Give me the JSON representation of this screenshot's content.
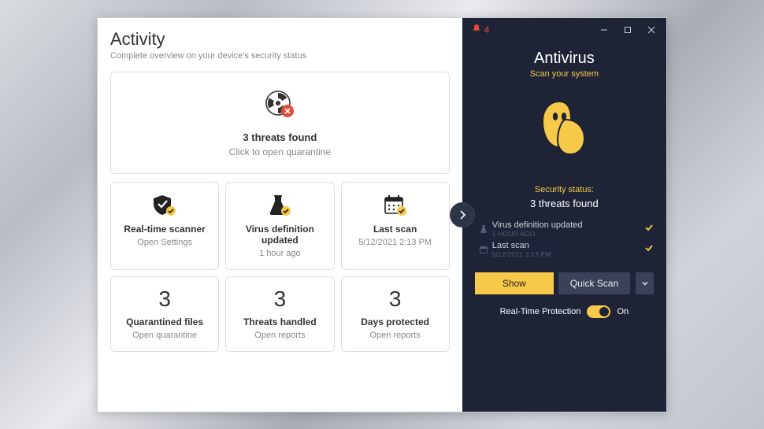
{
  "left": {
    "title": "Activity",
    "subtitle": "Complete overview on your device's security status",
    "hero": {
      "title": "3 threats found",
      "sub": "Click to open quarantine"
    },
    "cards": [
      {
        "title": "Real-time scanner",
        "sub": "Open Settings"
      },
      {
        "title": "Virus definition updated",
        "sub": "1 hour ago"
      },
      {
        "title": "Last scan",
        "sub": "5/12/2021 2:13 PM"
      },
      {
        "big": "3",
        "title": "Quarantined files",
        "sub": "Open quarantine"
      },
      {
        "big": "3",
        "title": "Threats handled",
        "sub": "Open reports"
      },
      {
        "big": "3",
        "title": "Days protected",
        "sub": "Open reports"
      }
    ]
  },
  "right": {
    "notif_count": "4",
    "title": "Antivirus",
    "sub": "Scan your system",
    "status_label": "Security status:",
    "status_value": "3 threats found",
    "rows": [
      {
        "title": "Virus definition updated",
        "sub": "1 HOUR AGO"
      },
      {
        "title": "Last scan",
        "sub": "5/12/2021 2:13 PM"
      }
    ],
    "show_label": "Show",
    "scan_label": "Quick Scan",
    "rtp_label": "Real-Time Protection",
    "rtp_state": "On"
  }
}
